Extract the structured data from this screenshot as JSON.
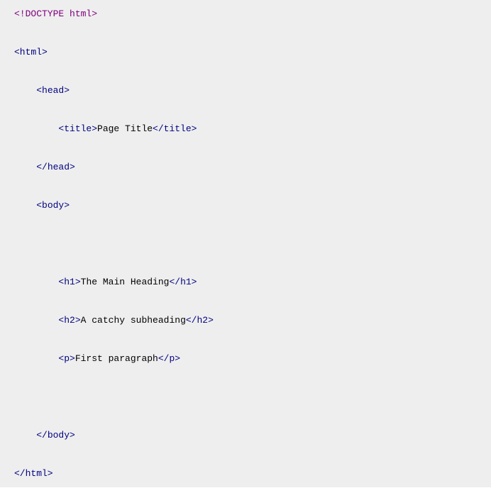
{
  "code": {
    "doctype": "<!DOCTYPE html>",
    "html_open": "<html>",
    "head_open": "<head>",
    "title_open": "<title>",
    "title_text": "Page Title",
    "title_close": "</title>",
    "head_close": "</head>",
    "body_open": "<body>",
    "h1_open": "<h1>",
    "h1_text": "The Main Heading",
    "h1_close": "</h1>",
    "h2_open": "<h2>",
    "h2_text": "A catchy subheading",
    "h2_close": "</h2>",
    "p_open": "<p>",
    "p_text": "First paragraph",
    "p_close": "</p>",
    "body_close": "</body>",
    "html_close": "</html>"
  },
  "indent": {
    "l0": "",
    "l1": "    ",
    "l2": "        "
  }
}
